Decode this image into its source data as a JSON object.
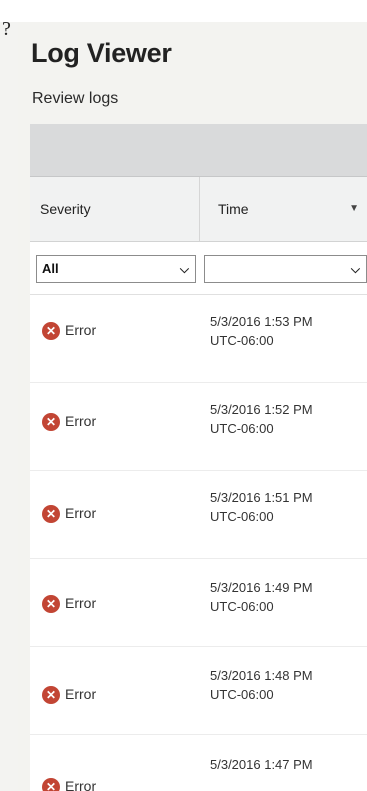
{
  "corner_glyph": "?",
  "app": {
    "title": "Log Viewer",
    "subtitle": "Review logs"
  },
  "table": {
    "columns": {
      "severity": "Severity",
      "time": "Time"
    },
    "filters": {
      "severity_selected": "All",
      "time_selected": ""
    },
    "rows": [
      {
        "severity": "Error",
        "date": "5/3/2016 1:53 PM",
        "tz": "UTC-06:00"
      },
      {
        "severity": "Error",
        "date": "5/3/2016 1:52 PM",
        "tz": "UTC-06:00"
      },
      {
        "severity": "Error",
        "date": "5/3/2016 1:51 PM",
        "tz": "UTC-06:00"
      },
      {
        "severity": "Error",
        "date": "5/3/2016 1:49 PM",
        "tz": "UTC-06:00"
      },
      {
        "severity": "Error",
        "date": "5/3/2016 1:48 PM",
        "tz": "UTC-06:00"
      },
      {
        "severity": "Error",
        "date": "5/3/2016 1:47 PM",
        "tz": ""
      }
    ]
  },
  "icons": {
    "error": "error-icon",
    "sort": "sort-desc-icon",
    "dropdown": "chevron-down-icon"
  },
  "colors": {
    "error": "#c24534",
    "toolbar": "#d9dadb",
    "header": "#f1f2f2"
  }
}
